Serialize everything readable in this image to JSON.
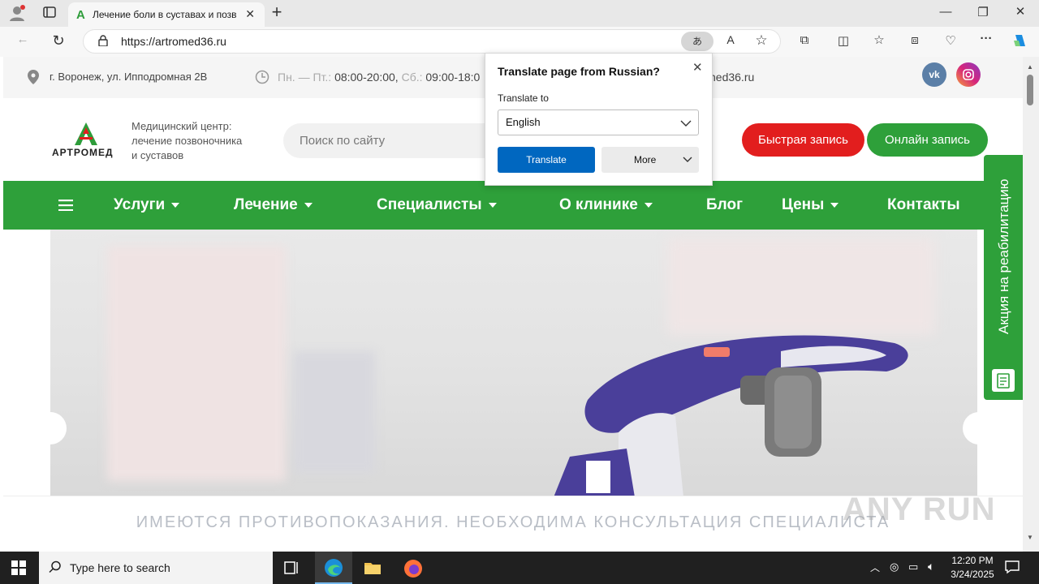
{
  "browser": {
    "tab_title": "Лечение боли в суставах и позв",
    "tab_favicon": "A",
    "url": "https://artromed36.ru",
    "icons": [
      "profile-icon",
      "tab-actions-icon",
      "back-icon",
      "refresh-icon",
      "lock-icon",
      "translate-icon",
      "read-aloud-icon",
      "favorite-star-icon",
      "extensions-icon",
      "split-screen-icon",
      "favorites-icon",
      "collections-icon",
      "performance-icon",
      "more-icon",
      "copilot-icon"
    ]
  },
  "topinfo": {
    "address": "г. Воронеж, ул. Ипподромная 2В",
    "hours_weekdays_label": "Пн. — Пт.:",
    "hours_weekdays": "08:00-20:00,",
    "hours_sat_label": "Сб.:",
    "hours_sat": "09:00-18:0",
    "email_fragment": "ned36.ru"
  },
  "header": {
    "logo_text": "АРТРОМЕД",
    "tagline_line1": "Медицинский центр:",
    "tagline_line2": "лечение позвоночника",
    "tagline_line3": "и суставов",
    "search_placeholder": "Поиск по сайту",
    "btn_quick": "Быстрая запись",
    "btn_online": "Онлайн запись"
  },
  "nav": {
    "items": [
      {
        "label": "Услуги",
        "dropdown": true
      },
      {
        "label": "Лечение",
        "dropdown": true
      },
      {
        "label": "Специалисты",
        "dropdown": true
      },
      {
        "label": "О клинике",
        "dropdown": true
      },
      {
        "label": "Блог",
        "dropdown": false
      },
      {
        "label": "Цены",
        "dropdown": true
      },
      {
        "label": "Контакты",
        "dropdown": false
      }
    ]
  },
  "side_tab": {
    "label": "Акция на реабилитацию"
  },
  "disclaimer": "ИМЕЮТСЯ ПРОТИВОПОКАЗАНИЯ. НЕОБХОДИМА КОНСУЛЬТАЦИЯ СПЕЦИАЛИСТА",
  "translate_popup": {
    "title": "Translate page from Russian?",
    "translate_to_label": "Translate to",
    "language": "English",
    "translate_button": "Translate",
    "more_button": "More"
  },
  "taskbar": {
    "search_placeholder": "Type here to search",
    "time": "12:20 PM",
    "date": "3/24/2025"
  },
  "watermark": "ANY RUN",
  "colors": {
    "brand_green": "#2ea03a",
    "brand_red": "#e21e1e",
    "edge_blue": "#0067c0"
  }
}
